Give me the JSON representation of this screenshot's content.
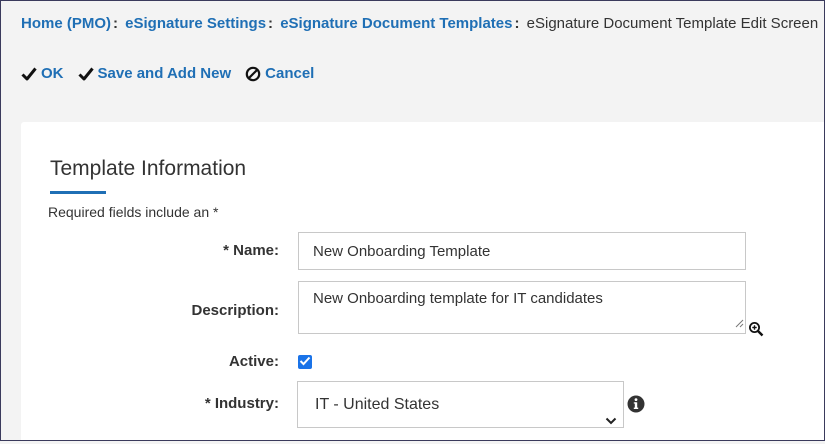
{
  "breadcrumb": {
    "items": [
      "Home (PMO)",
      "eSignature Settings",
      "eSignature Document Templates"
    ],
    "separator": ":",
    "current": "eSignature Document Template Edit Screen"
  },
  "toolbar": {
    "ok_label": "OK",
    "save_add_new_label": "Save and Add New",
    "cancel_label": "Cancel"
  },
  "form": {
    "section_title": "Template Information",
    "required_note": "Required fields include an *",
    "name_label": "* Name:",
    "name_value": "New Onboarding Template",
    "description_label": "Description:",
    "description_value": "New Onboarding template for IT candidates",
    "active_label": "Active:",
    "active_checked": true,
    "industry_label": "* Industry:",
    "industry_value": "IT - United States"
  },
  "icons": {
    "check": "check-icon",
    "cancel": "cancel-circle-icon",
    "zoom": "zoom-in-icon",
    "info": "info-icon",
    "chevron": "chevron-down-icon"
  },
  "colors": {
    "link": "#1f6fb5",
    "accent": "#1a73e8",
    "background": "#f3f3f3",
    "panel": "#ffffff"
  }
}
